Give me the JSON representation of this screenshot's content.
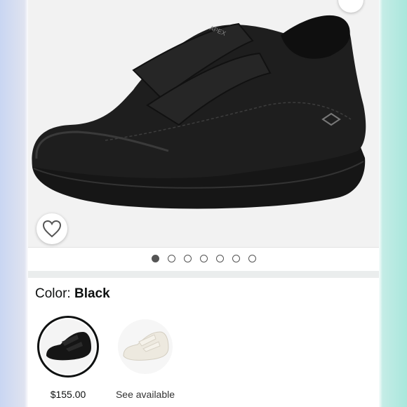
{
  "gallery": {
    "image_alt": "Apex black leather double-strap sneaker",
    "brand_mark": "APEX",
    "slide_count": 7,
    "active_slide": 1
  },
  "color_selector": {
    "label": "Color:",
    "selected_value": "Black",
    "options": [
      {
        "name": "Black",
        "caption": "$155.00",
        "selected": true
      },
      {
        "name": "White",
        "caption": "See available",
        "selected": false
      }
    ]
  },
  "colors": {
    "accent_dark": "#0f1111",
    "divider": "#eaeded",
    "image_bg": "#f2f2f2"
  },
  "icons": [
    "share-icon",
    "heart-icon"
  ]
}
